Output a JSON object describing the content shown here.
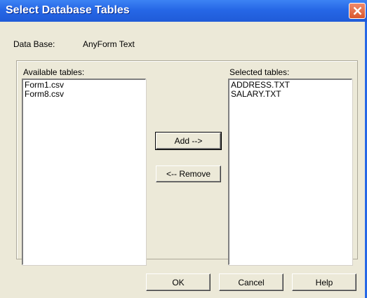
{
  "window": {
    "title": "Select Database Tables"
  },
  "database": {
    "label": "Data Base:",
    "value": "AnyForm Text"
  },
  "available": {
    "label": "Available tables:",
    "items": [
      "Form1.csv",
      "Form8.csv"
    ]
  },
  "selected": {
    "label": "Selected tables:",
    "items": [
      "ADDRESS.TXT",
      "SALARY.TXT"
    ]
  },
  "buttons": {
    "add": "Add -->",
    "remove": "<-- Remove",
    "ok": "OK",
    "cancel": "Cancel",
    "help": "Help"
  },
  "colors": {
    "titlebar": "#2667e6",
    "dialog_bg": "#ece9d8",
    "close_button": "#d9572d"
  }
}
